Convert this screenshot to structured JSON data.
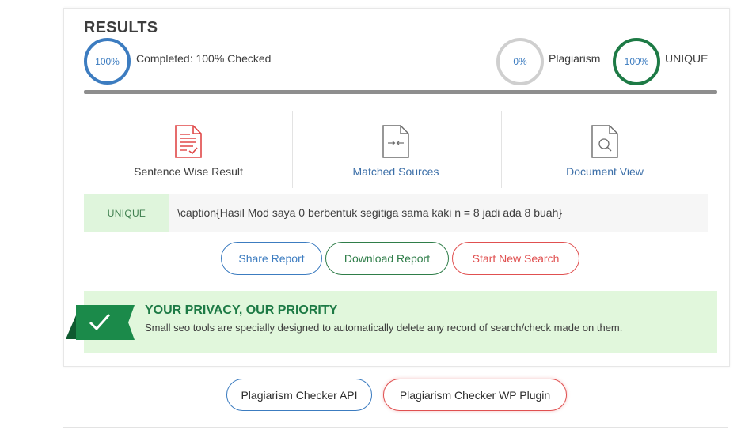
{
  "results": {
    "title": "RESULTS",
    "completed_value": "100%",
    "completed_label": "Completed: 100% Checked",
    "plagiarism_value": "0%",
    "plagiarism_label": "Plagiarism",
    "unique_value": "100%",
    "unique_label": "UNIQUE",
    "progress_fraction": 1.0
  },
  "views": [
    {
      "label": "Sentence Wise Result",
      "icon": "document-check-icon",
      "color": "#3d3d3d"
    },
    {
      "label": "Matched Sources",
      "icon": "compare-arrows-document-icon",
      "color": "#3c6fa8"
    },
    {
      "label": "Document View",
      "icon": "document-search-icon",
      "color": "#3c6fa8"
    }
  ],
  "sentence_row": {
    "badge": "UNIQUE",
    "text": "\\caption{Hasil Mod saya 0 berbentuk segitiga sama kaki n = 8 jadi ada 8 buah}"
  },
  "actions": {
    "share": "Share Report",
    "download": "Download Report",
    "new_search": "Start New Search"
  },
  "privacy": {
    "title": "YOUR PRIVACY, OUR PRIORITY",
    "text": "Small seo tools are specially designed to automatically delete any record of search/check made on them."
  },
  "footer_buttons": {
    "api": "Plagiarism Checker API",
    "wp_plugin": "Plagiarism Checker WP Plugin"
  },
  "colors": {
    "blue": "#3c7cc0",
    "green": "#1d7a45",
    "red": "#e05050",
    "light_green": "#e1f7dc"
  }
}
